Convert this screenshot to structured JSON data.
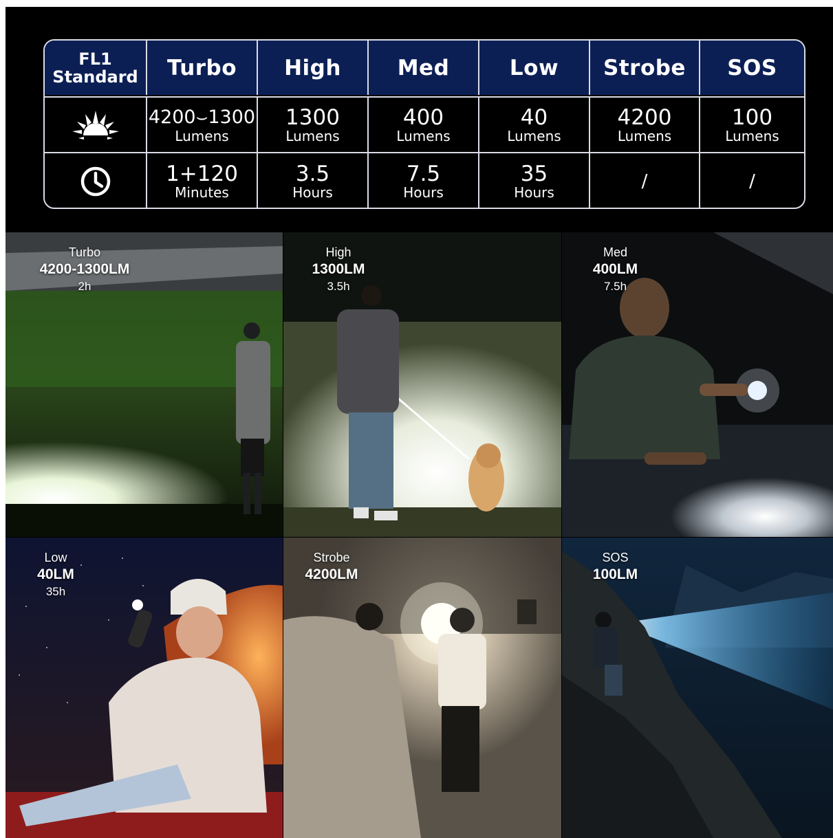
{
  "table": {
    "corner_line1": "FL1",
    "corner_line2": "Standard",
    "modes": [
      "Turbo",
      "High",
      "Med",
      "Low",
      "Strobe",
      "SOS"
    ],
    "brightness_icon": "sun-rays-icon",
    "runtime_icon": "clock-icon",
    "brightness": [
      {
        "value": "4200⌣1300",
        "unit": "Lumens"
      },
      {
        "value": "1300",
        "unit": "Lumens"
      },
      {
        "value": "400",
        "unit": "Lumens"
      },
      {
        "value": "40",
        "unit": "Lumens"
      },
      {
        "value": "4200",
        "unit": "Lumens"
      },
      {
        "value": "100",
        "unit": "Lumens"
      }
    ],
    "runtime": [
      {
        "value": "1+120",
        "unit": "Minutes"
      },
      {
        "value": "3.5",
        "unit": "Hours"
      },
      {
        "value": "7.5",
        "unit": "Hours"
      },
      {
        "value": "35",
        "unit": "Hours"
      },
      {
        "value": "/",
        "unit": ""
      },
      {
        "value": "/",
        "unit": ""
      }
    ],
    "colors": {
      "header_bg": "#0c1f55",
      "border": "#d9dce6",
      "background": "#000000"
    }
  },
  "photos": [
    {
      "mode": "Turbo",
      "lumens": "4200-1300LM",
      "time": "2h"
    },
    {
      "mode": "High",
      "lumens": "1300LM",
      "time": "3.5h"
    },
    {
      "mode": "Med",
      "lumens": "400LM",
      "time": "7.5h"
    },
    {
      "mode": "Low",
      "lumens": "40LM",
      "time": "35h"
    },
    {
      "mode": "Strobe",
      "lumens": "4200LM",
      "time": ""
    },
    {
      "mode": "SOS",
      "lumens": "100LM",
      "time": ""
    }
  ]
}
